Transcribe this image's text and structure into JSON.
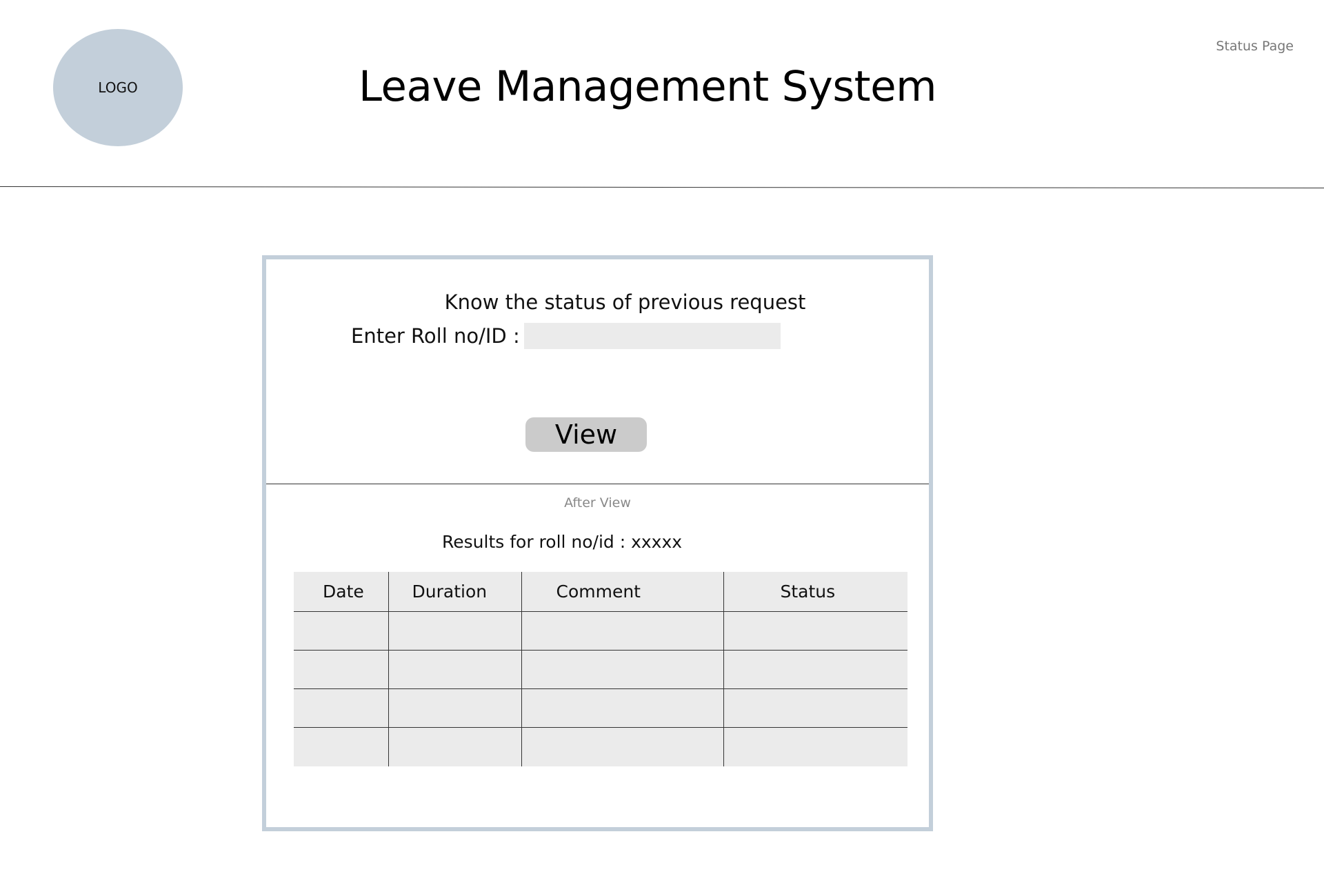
{
  "header": {
    "logo_text": "LOGO",
    "app_title": "Leave Management System",
    "page_label": "Status Page"
  },
  "status_form": {
    "heading": "Know the status of previous request",
    "roll_label": "Enter Roll no/ID :",
    "roll_value": "",
    "roll_placeholder": "",
    "view_button": "View"
  },
  "results": {
    "after_view_label": "After View",
    "results_label": "Results for roll no/id : xxxxx",
    "columns": [
      "Date",
      "Duration",
      "Comment",
      "Status"
    ],
    "rows": [
      [
        "",
        "",
        "",
        ""
      ],
      [
        "",
        "",
        "",
        ""
      ],
      [
        "",
        "",
        "",
        ""
      ],
      [
        "",
        "",
        "",
        ""
      ]
    ]
  },
  "colors": {
    "logo_fill": "#c3cfda",
    "panel_border": "#c3cfda",
    "input_fill": "#ebebeb",
    "button_fill": "#cbcbcb",
    "table_fill": "#ebebeb"
  }
}
